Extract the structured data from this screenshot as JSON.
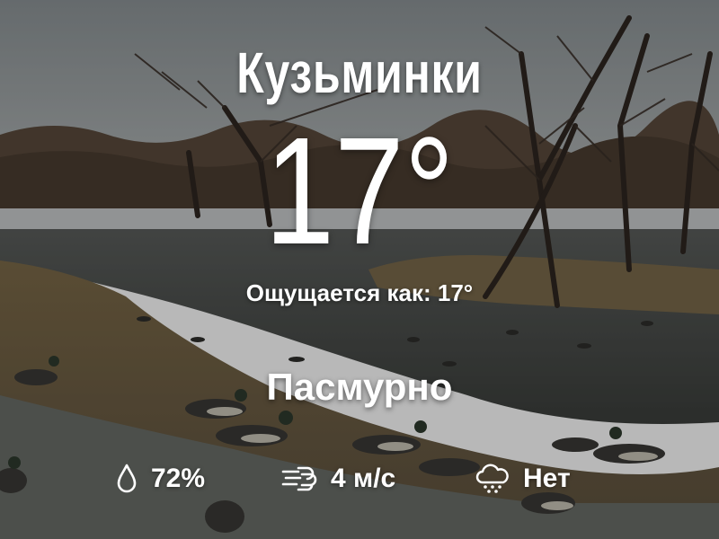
{
  "location": {
    "name": "Кузьминки"
  },
  "current": {
    "temperature": "17°",
    "feels_like_label": "Ощущается как:",
    "feels_like_value": "17°",
    "condition": "Пасмурно"
  },
  "details": {
    "humidity": {
      "icon": "droplet-icon",
      "value": "72%"
    },
    "wind": {
      "icon": "wind-icon",
      "value": "4 м/с"
    },
    "precipitation": {
      "icon": "rain-cloud-icon",
      "value": "Нет"
    }
  }
}
